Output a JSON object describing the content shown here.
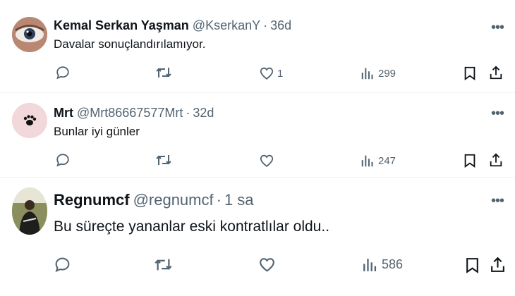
{
  "tweets": [
    {
      "name": "Kemal Serkan Yaşman",
      "handle": "@KserkanY",
      "separator": "·",
      "time": "36d",
      "text": "Davalar sonuçlandırılamıyor.",
      "likes": "1",
      "views": "299",
      "avatar_icon": "eye-avatar-icon"
    },
    {
      "name": "Mrt",
      "handle": "@Mrt86667577Mrt",
      "separator": "·",
      "time": "32d",
      "text": "Bunlar iyi günler",
      "likes": "",
      "views": "247",
      "avatar_icon": "paw-avatar-icon"
    },
    {
      "name": "Regnumcf",
      "handle": "@regnumcf",
      "separator": "·",
      "time": "1 sa",
      "text": "Bu süreçte yananlar eski kontratlılar oldu..",
      "likes": "",
      "views": "586",
      "avatar_icon": "person-photo-avatar-icon"
    }
  ],
  "icons": {
    "reply": "reply-icon",
    "retweet": "retweet-icon",
    "like": "heart-icon",
    "views": "views-chart-icon",
    "bookmark": "bookmark-icon",
    "share": "share-icon",
    "more": "more-options-icon"
  },
  "colors": {
    "text": "#0f1419",
    "secondary": "#536471",
    "separator": "#eff3f4"
  }
}
